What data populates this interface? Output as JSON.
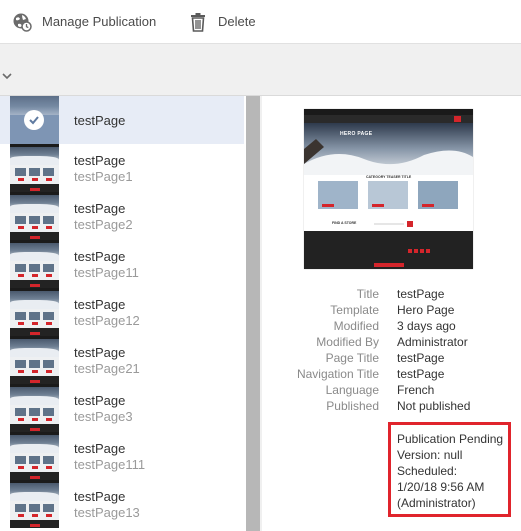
{
  "toolbar": {
    "manage_label": "Manage Publication",
    "delete_label": "Delete"
  },
  "list": {
    "items": [
      {
        "title": "testPage",
        "name": "",
        "selected": true
      },
      {
        "title": "testPage",
        "name": "testPage1"
      },
      {
        "title": "testPage",
        "name": "testPage2"
      },
      {
        "title": "testPage",
        "name": "testPage11"
      },
      {
        "title": "testPage",
        "name": "testPage12"
      },
      {
        "title": "testPage",
        "name": "testPage21"
      },
      {
        "title": "testPage",
        "name": "testPage3"
      },
      {
        "title": "testPage",
        "name": "testPage111"
      },
      {
        "title": "testPage",
        "name": "testPage13"
      }
    ]
  },
  "preview": {
    "hero_title": "HERO PAGE",
    "teaser_title": "CATEGORY TEASER TITLE",
    "find_store": "FIND A STORE"
  },
  "details": {
    "rows": [
      {
        "label": "Title",
        "value": "testPage"
      },
      {
        "label": "Template",
        "value": "Hero Page"
      },
      {
        "label": "Modified",
        "value": "3 days ago"
      },
      {
        "label": "Modified By",
        "value": "Administrator"
      },
      {
        "label": "Page Title",
        "value": "testPage"
      },
      {
        "label": "Navigation Title",
        "value": "testPage"
      },
      {
        "label": "Language",
        "value": "French"
      },
      {
        "label": "Published",
        "value": "Not published"
      }
    ],
    "pending": {
      "line1": "Publication Pending",
      "line2": "Version: null",
      "line3": "Scheduled:",
      "line4": "1/20/18 9:56 AM",
      "line5": "(Administrator)"
    }
  },
  "colors": {
    "selected_row": "#e7ecf6",
    "highlight_border": "#e0242c",
    "brand_red": "#d4252b"
  }
}
